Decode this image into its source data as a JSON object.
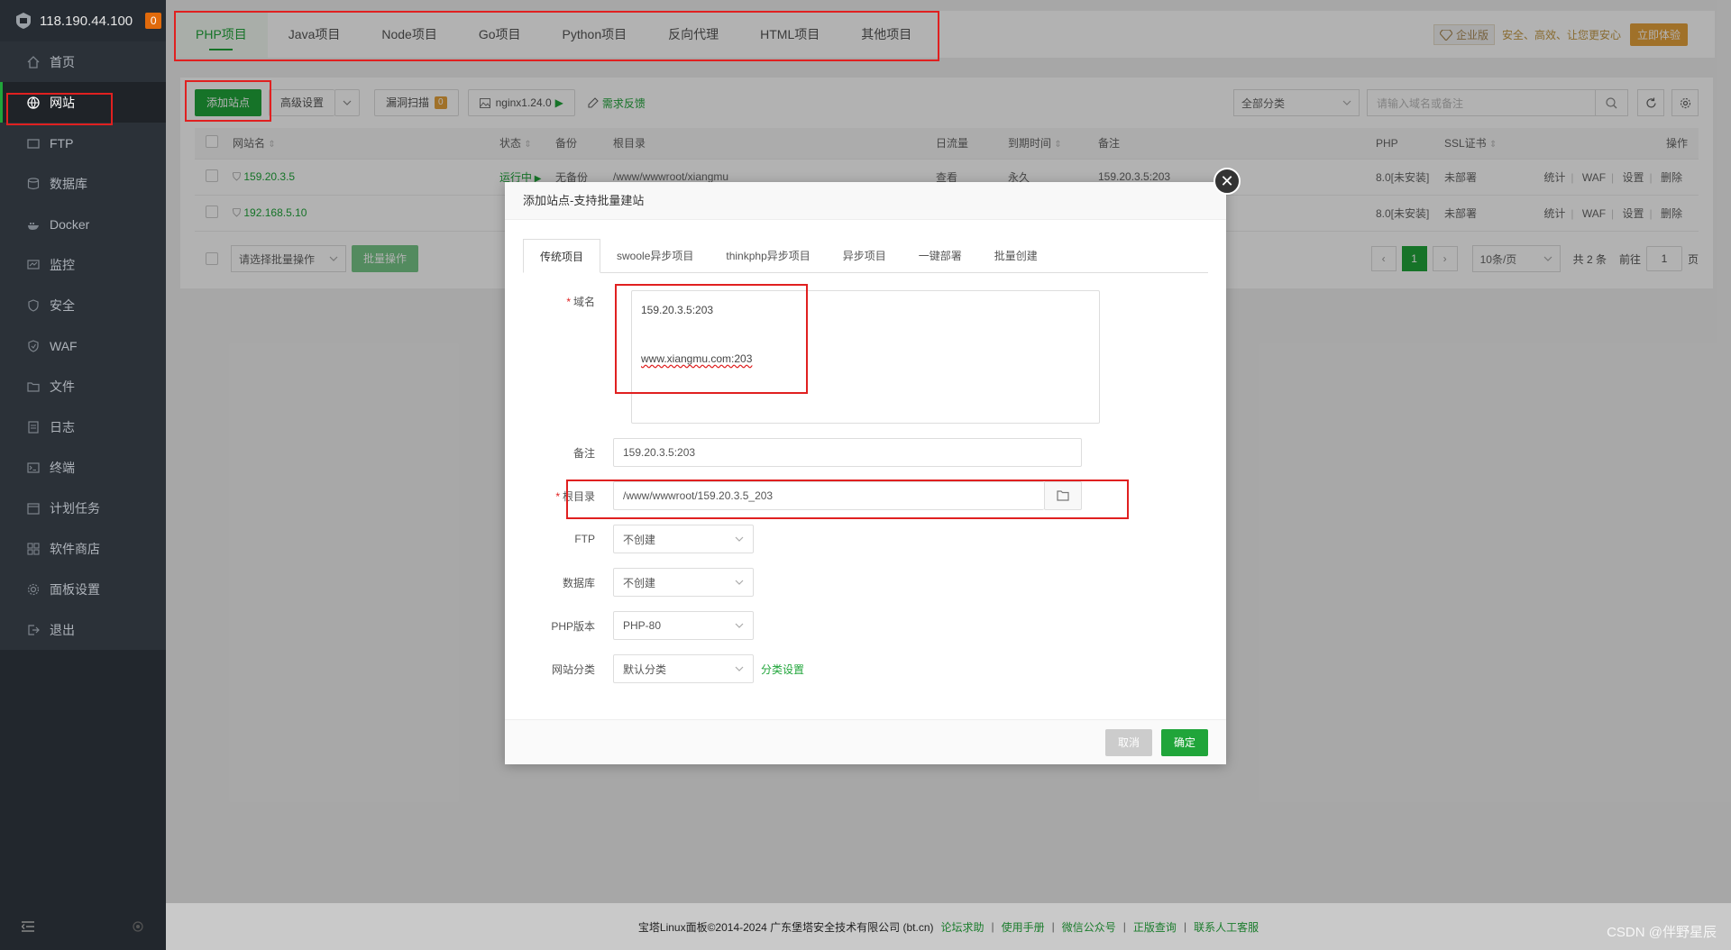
{
  "sidebar": {
    "server_ip": "118.190.44.100",
    "notice_count": "0",
    "items": [
      {
        "label": "首页",
        "icon": "home-icon"
      },
      {
        "label": "网站",
        "icon": "globe-icon"
      },
      {
        "label": "FTP",
        "icon": "ftp-icon"
      },
      {
        "label": "数据库",
        "icon": "database-icon"
      },
      {
        "label": "Docker",
        "icon": "docker-icon"
      },
      {
        "label": "监控",
        "icon": "monitor-icon"
      },
      {
        "label": "安全",
        "icon": "shield-icon"
      },
      {
        "label": "WAF",
        "icon": "waf-icon"
      },
      {
        "label": "文件",
        "icon": "folder-icon"
      },
      {
        "label": "日志",
        "icon": "log-icon"
      },
      {
        "label": "终端",
        "icon": "terminal-icon"
      },
      {
        "label": "计划任务",
        "icon": "calendar-icon"
      },
      {
        "label": "软件商店",
        "icon": "grid-icon"
      },
      {
        "label": "面板设置",
        "icon": "gear-icon"
      },
      {
        "label": "退出",
        "icon": "logout-icon"
      }
    ]
  },
  "topbar": {
    "tabs": [
      "PHP项目",
      "Java项目",
      "Node项目",
      "Go项目",
      "Python项目",
      "反向代理",
      "HTML项目",
      "其他项目"
    ],
    "promo": {
      "vip": "企业版",
      "slogan": "安全、高效、让您更安心",
      "try": "立即体验"
    }
  },
  "toolbar": {
    "add_site": "添加站点",
    "advanced": "高级设置",
    "vuln_scan": "漏洞扫描",
    "vuln_count": "0",
    "nginx": "nginx1.24.0",
    "feedback": "需求反馈",
    "category": "全部分类",
    "search_placeholder": "请输入域名或备注"
  },
  "table": {
    "headers": {
      "name": "网站名",
      "status": "状态",
      "backup": "备份",
      "root": "根目录",
      "traffic": "日流量",
      "expire": "到期时间",
      "remark": "备注",
      "php": "PHP",
      "ssl": "SSL证书",
      "ops": "操作"
    },
    "rows": [
      {
        "name": "159.20.3.5",
        "status": "运行中",
        "backup": "无备份",
        "root": "/www/wwwroot/xiangmu",
        "traffic": "查看",
        "expire": "永久",
        "remark": "159.20.3.5:203",
        "php": "8.0[未安装]",
        "ssl": "未部署",
        "ops": [
          "统计",
          "WAF",
          "设置",
          "删除"
        ]
      },
      {
        "name": "192.168.5.10",
        "status": "",
        "backup": "",
        "root": "",
        "traffic": "",
        "expire": "",
        "remark": "",
        "php": "8.0[未安装]",
        "ssl": "未部署",
        "ops": [
          "统计",
          "WAF",
          "设置",
          "删除"
        ]
      }
    ]
  },
  "bulk": {
    "select": "请选择批量操作",
    "apply": "批量操作"
  },
  "pager": {
    "current": "1",
    "page_size": "10条/页",
    "total": "共 2 条",
    "goto_label": "前往",
    "goto_value": "1",
    "page_unit": "页"
  },
  "modal": {
    "title": "添加站点-支持批量建站",
    "tabs": [
      "传统项目",
      "swoole异步项目",
      "thinkphp异步项目",
      "异步项目",
      "一键部署",
      "批量创建"
    ],
    "domain_label": "域名",
    "domain_line1": "159.20.3.5:203",
    "domain_line2": "www.xiangmu.com:203",
    "remark_label": "备注",
    "remark_value": "159.20.3.5:203",
    "root_label": "根目录",
    "root_value": "/www/wwwroot/159.20.3.5_203",
    "ftp_label": "FTP",
    "ftp_value": "不创建",
    "db_label": "数据库",
    "db_value": "不创建",
    "php_label": "PHP版本",
    "php_value": "PHP-80",
    "cat_label": "网站分类",
    "cat_value": "默认分类",
    "cat_link": "分类设置",
    "cancel": "取消",
    "ok": "确定"
  },
  "footer": {
    "copyright": "宝塔Linux面板©2014-2024 广东堡塔安全技术有限公司 (bt.cn)",
    "links": [
      "论坛求助",
      "使用手册",
      "微信公众号",
      "正版查询",
      "联系人工客服"
    ]
  },
  "watermark": "CSDN @伴野星辰",
  "colors": {
    "brand": "#20a53a",
    "annotation": "#e02020",
    "sidebar_bg": "#2b3138"
  }
}
